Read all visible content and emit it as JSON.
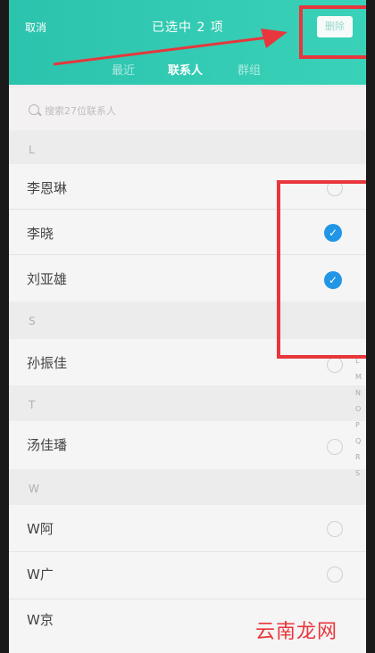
{
  "header": {
    "cancel": "取消",
    "title": "已选中 2 项",
    "delete": "删除"
  },
  "tabs": [
    {
      "label": "最近"
    },
    {
      "label": "联系人"
    },
    {
      "label": "群组"
    }
  ],
  "search": {
    "placeholder": "搜索27位联系人"
  },
  "sections": [
    {
      "letter": "L",
      "contacts": [
        {
          "name": "李恩琳",
          "checked": false
        },
        {
          "name": "李晓",
          "checked": true
        },
        {
          "name": "刘亚雄",
          "checked": true
        }
      ]
    },
    {
      "letter": "S",
      "contacts": [
        {
          "name": "孙振佳",
          "checked": false
        }
      ]
    },
    {
      "letter": "T",
      "contacts": [
        {
          "name": "汤佳璠",
          "checked": false
        }
      ]
    },
    {
      "letter": "W",
      "contacts": [
        {
          "name": "W阿",
          "checked": false
        },
        {
          "name": "W广",
          "checked": false
        },
        {
          "name": "W京",
          "checked": false
        }
      ]
    }
  ],
  "index_letters": [
    "L",
    "M",
    "N",
    "O",
    "P",
    "Q",
    "R",
    "S"
  ],
  "watermark": "云南龙网",
  "colors": {
    "accent": "#2cc3ad",
    "check": "#2196e6",
    "highlight": "#e8363c"
  }
}
